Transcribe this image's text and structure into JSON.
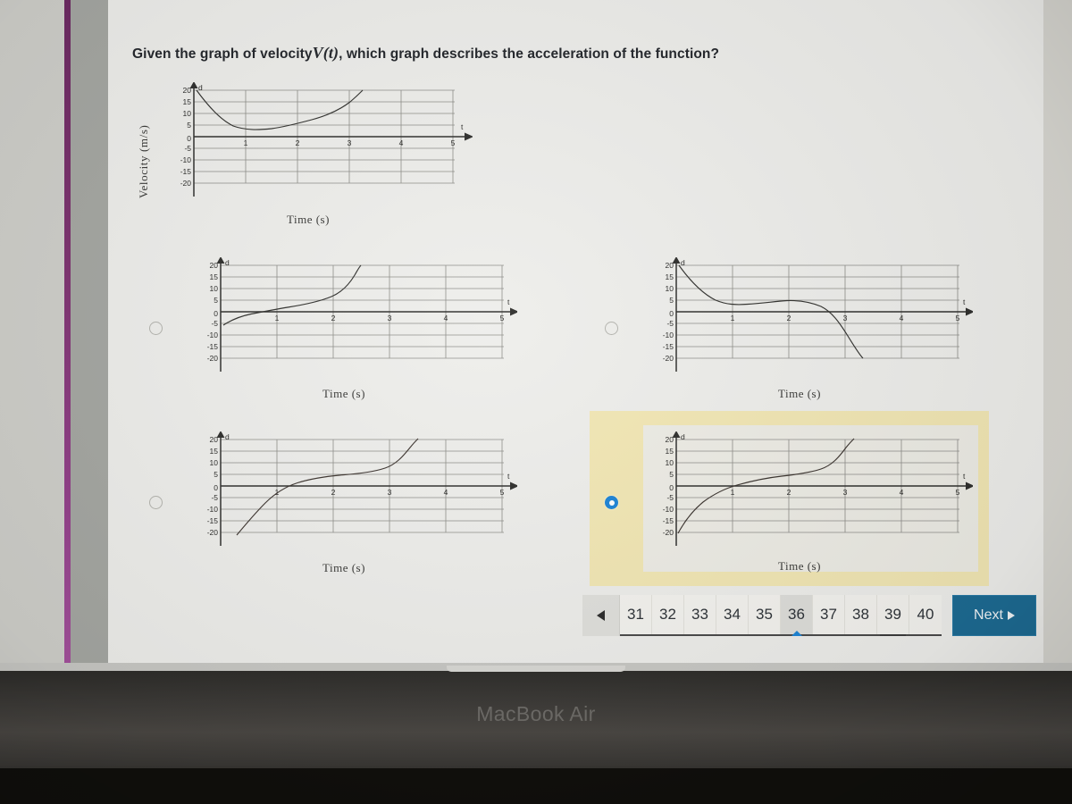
{
  "question": {
    "prefix": "Given the graph of velocity",
    "variable": "V(t)",
    "suffix": ", which graph describes the acceleration of the function?"
  },
  "reference_graph": {
    "y_axis_label": "Velocity (m/s)",
    "x_axis_label": "Time (s)",
    "y_arrow_label": "d",
    "x_arrow_label": "t"
  },
  "options": [
    {
      "id": "option-a",
      "selected": false,
      "x_axis_label": "Time (s)",
      "y_arrow_label": "d",
      "x_arrow_label": "t"
    },
    {
      "id": "option-b",
      "selected": false,
      "x_axis_label": "Time (s)",
      "y_arrow_label": "d",
      "x_arrow_label": "t"
    },
    {
      "id": "option-c",
      "selected": false,
      "x_axis_label": "Time (s)",
      "y_arrow_label": "d",
      "x_arrow_label": "t"
    },
    {
      "id": "option-d",
      "selected": true,
      "x_axis_label": "Time (s)",
      "y_arrow_label": "d",
      "x_arrow_label": "t"
    }
  ],
  "chart_data": [
    {
      "name": "reference",
      "type": "line",
      "title": "",
      "xlabel": "Time (s)",
      "ylabel": "Velocity (m/s)",
      "xlim": [
        0,
        5
      ],
      "ylim": [
        -20,
        20
      ],
      "xticks": [
        1,
        2,
        3,
        4,
        5
      ],
      "yticks": [
        20,
        15,
        10,
        5,
        0,
        -5,
        -10,
        -15,
        -20
      ],
      "grid": true,
      "x": [
        0,
        0.25,
        0.5,
        0.75,
        1.0,
        1.25,
        1.5,
        1.75,
        2.0,
        2.25,
        2.5,
        2.75,
        3.0,
        3.25,
        3.5
      ],
      "y": [
        20,
        13,
        8.5,
        5.5,
        4,
        3.2,
        3.2,
        3.8,
        5,
        6.2,
        7.6,
        9.2,
        11.5,
        15,
        20
      ]
    },
    {
      "name": "option-a",
      "type": "line",
      "xlabel": "Time (s)",
      "ylabel": "",
      "xlim": [
        0,
        5
      ],
      "ylim": [
        -20,
        20
      ],
      "xticks": [
        1,
        2,
        3,
        4,
        5
      ],
      "yticks": [
        20,
        15,
        10,
        5,
        0,
        -5,
        -10,
        -15,
        -20
      ],
      "grid": true,
      "x": [
        0,
        0.2,
        0.4,
        0.7,
        1.0,
        1.3,
        1.6,
        1.9,
        2.1,
        2.3,
        2.5,
        2.65,
        2.8
      ],
      "y": [
        -5.5,
        -3.2,
        -1.2,
        0.6,
        1.8,
        2.6,
        3.3,
        4.3,
        5.6,
        7.6,
        11,
        15,
        20
      ]
    },
    {
      "name": "option-b",
      "type": "line",
      "xlabel": "Time (s)",
      "ylabel": "",
      "xlim": [
        0,
        5
      ],
      "ylim": [
        -20,
        20
      ],
      "xticks": [
        1,
        2,
        3,
        4,
        5
      ],
      "yticks": [
        20,
        15,
        10,
        5,
        0,
        -5,
        -10,
        -15,
        -20
      ],
      "grid": true,
      "x": [
        0,
        0.25,
        0.5,
        0.75,
        1.0,
        1.3,
        1.6,
        1.9,
        2.1,
        2.4,
        2.7,
        3.0,
        3.2,
        3.4,
        3.6
      ],
      "y": [
        20,
        13.5,
        8.5,
        5.2,
        3.5,
        3.3,
        3.8,
        4.6,
        5.0,
        4.8,
        3.2,
        0,
        -4,
        -11,
        -20
      ]
    },
    {
      "name": "option-c",
      "type": "line",
      "xlabel": "Time (s)",
      "ylabel": "",
      "xlim": [
        0,
        5
      ],
      "ylim": [
        -20,
        20
      ],
      "xticks": [
        1,
        2,
        3,
        4,
        5
      ],
      "yticks": [
        20,
        15,
        10,
        5,
        0,
        -5,
        -10,
        -15,
        -20
      ],
      "grid": true,
      "x": [
        0.35,
        0.55,
        0.75,
        1.0,
        1.3,
        1.6,
        2.0,
        2.4,
        2.8,
        3.1,
        3.3,
        3.5,
        3.7
      ],
      "y": [
        -20,
        -14,
        -8.5,
        -3.5,
        0.5,
        2.8,
        4.6,
        5.2,
        6.5,
        8.5,
        11.5,
        16,
        21
      ]
    },
    {
      "name": "option-d",
      "type": "line",
      "xlabel": "Time (s)",
      "ylabel": "",
      "xlim": [
        0,
        5
      ],
      "ylim": [
        -20,
        20
      ],
      "xticks": [
        1,
        2,
        3,
        4,
        5
      ],
      "yticks": [
        20,
        15,
        10,
        5,
        0,
        -5,
        -10,
        -15,
        -20
      ],
      "grid": true,
      "x": [
        0.05,
        0.2,
        0.4,
        0.65,
        0.9,
        1.2,
        1.6,
        2.0,
        2.3,
        2.6,
        2.85,
        3.05,
        3.2,
        3.35
      ],
      "y": [
        -20,
        -14,
        -9,
        -5,
        -1.5,
        1.2,
        3.2,
        4.5,
        5.2,
        7,
        10,
        13.5,
        17,
        21
      ]
    }
  ],
  "pagination": {
    "prev_label": "",
    "pages": [
      "31",
      "32",
      "33",
      "34",
      "35",
      "36",
      "37",
      "38",
      "39",
      "40"
    ],
    "current": "36",
    "marked": [
      "39"
    ],
    "next_label": "Next"
  },
  "device": {
    "brand": "MacBook Air"
  },
  "colors": {
    "accent_blue": "#1c84d6",
    "next_button": "#1d6b93",
    "highlight_yellow": "#f2e7b4",
    "stripe_purple": "#7e3370",
    "page_background": "#eeeeeb"
  }
}
